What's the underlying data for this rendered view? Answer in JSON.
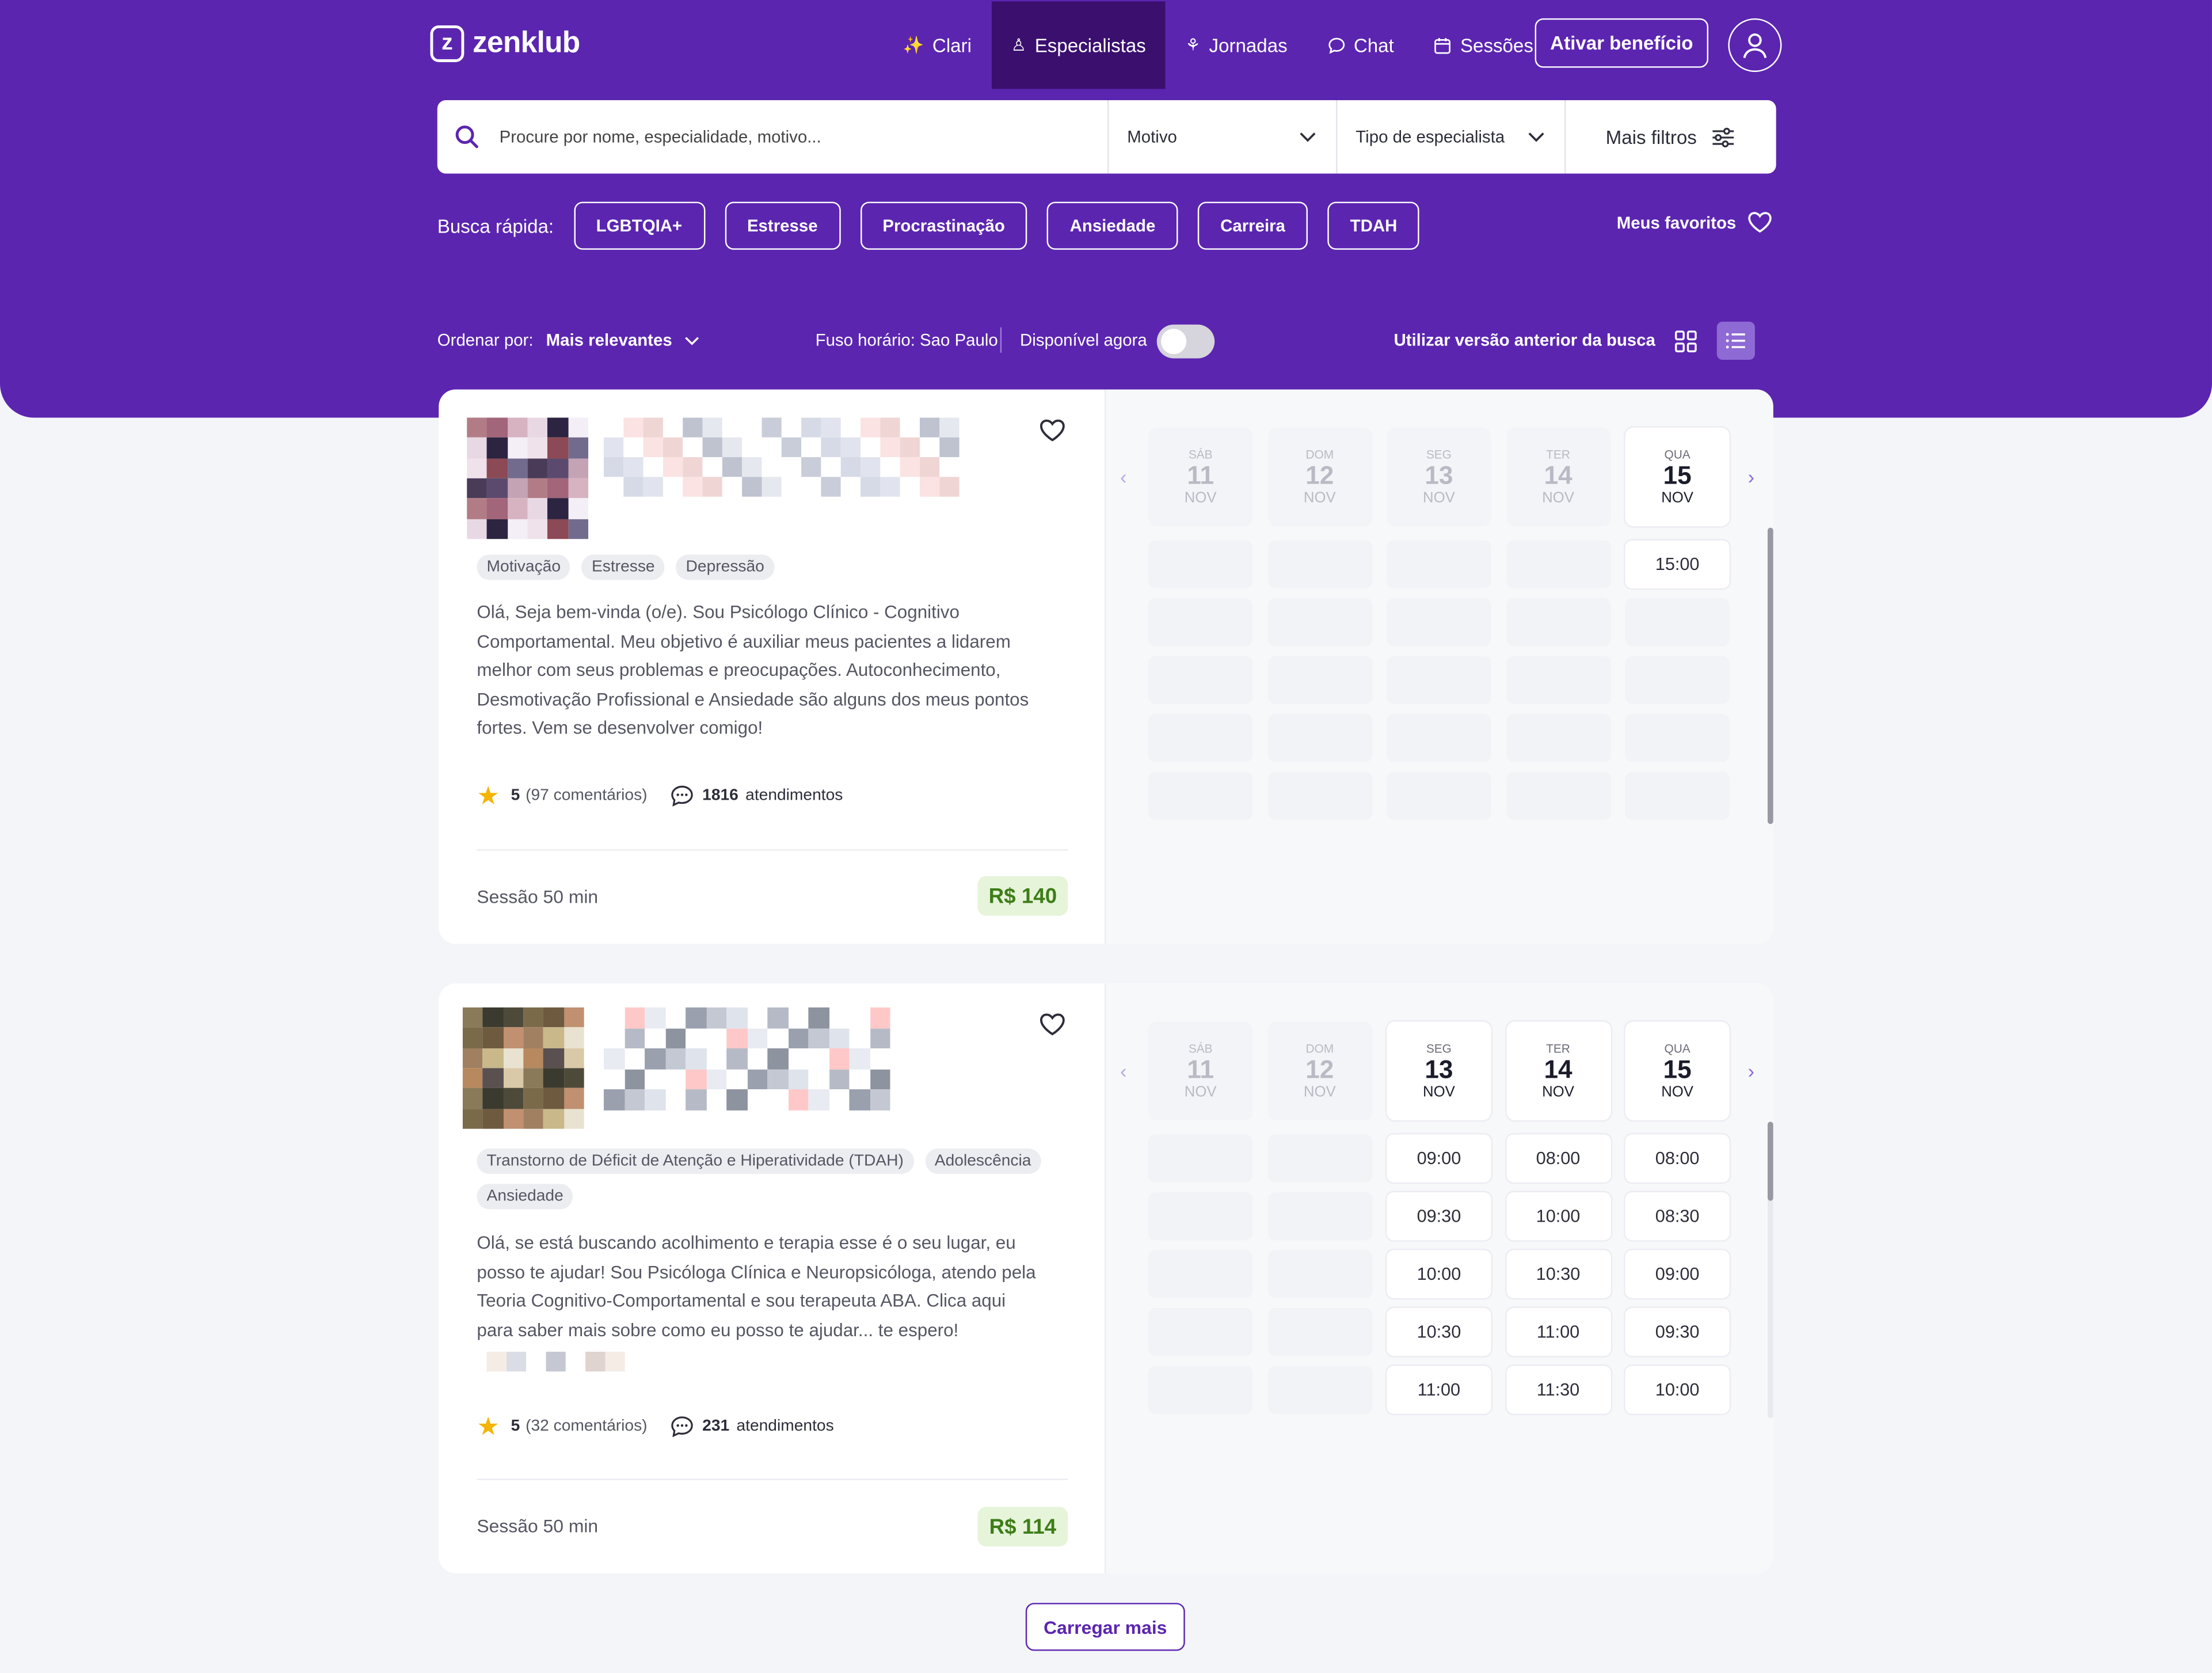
{
  "brand": {
    "name": "zenklub",
    "mark": "z",
    "primary": "#5b25b0"
  },
  "nav": {
    "items": [
      {
        "label": "Clari",
        "icon": "sparkles-icon",
        "glyph": "✨"
      },
      {
        "label": "Especialistas",
        "icon": "specialist-icon",
        "glyph": "♙"
      },
      {
        "label": "Jornadas",
        "icon": "journey-icon",
        "glyph": "⚘"
      },
      {
        "label": "Chat",
        "icon": "chat-icon",
        "glyph": "◌"
      },
      {
        "label": "Sessões",
        "icon": "calendar-icon",
        "glyph": "▦"
      }
    ],
    "active": "Especialistas",
    "benefit_button": "Ativar benefício"
  },
  "search": {
    "placeholder": "Procure por nome, especialidade, motivo...",
    "motivo": "Motivo",
    "tipo": "Tipo de especialista",
    "mais_filtros": "Mais filtros"
  },
  "quick": {
    "label": "Busca rápida:",
    "chips": [
      "LGBTQIA+",
      "Estresse",
      "Procrastinação",
      "Ansiedade",
      "Carreira",
      "TDAH"
    ],
    "favorites": "Meus favoritos"
  },
  "sort": {
    "label": "Ordenar por:",
    "value": "Mais relevantes",
    "timezone": "Fuso horário: Sao Paulo",
    "available_now": "Disponível agora",
    "available_now_on": false,
    "old_version": "Utilizar versão anterior da busca",
    "view_mode": "list"
  },
  "cards": [
    {
      "tags": [
        "Motivação",
        "Estresse",
        "Depressão"
      ],
      "bio": "Olá, Seja bem-vinda (o/e). Sou Psicólogo Clínico - Cognitivo Comportamental. Meu objetivo é auxiliar meus pacientes a lidarem melhor com seus problemas e preocupações. Autoconhecimento, Desmotivação Profissional e Ansiedade são alguns dos meus pontos fortes. Vem se desenvolver comigo!",
      "rating": "5",
      "reviews": "(97 comentários)",
      "sessions": "1816",
      "sessions_label": "atendimentos",
      "duration": "Sessão 50 min",
      "price": "R$ 140",
      "days": [
        {
          "dw": "SÁB",
          "dn": "11",
          "dm": "NOV",
          "on": false,
          "slots": []
        },
        {
          "dw": "DOM",
          "dn": "12",
          "dm": "NOV",
          "on": false,
          "slots": []
        },
        {
          "dw": "SEG",
          "dn": "13",
          "dm": "NOV",
          "on": false,
          "slots": []
        },
        {
          "dw": "TER",
          "dn": "14",
          "dm": "NOV",
          "on": false,
          "slots": []
        },
        {
          "dw": "QUA",
          "dn": "15",
          "dm": "NOV",
          "on": true,
          "slots": [
            "15:00"
          ]
        }
      ]
    },
    {
      "tags": [
        "Transtorno de Déficit de Atenção e Hiperatividade (TDAH)",
        "Adolescência",
        "Ansiedade"
      ],
      "bio": "Olá, se está buscando acolhimento e terapia esse é o seu lugar, eu posso te ajudar! Sou Psicóloga Clínica e Neuropsicóloga, atendo pela Teoria Cognitivo-Comportamental e sou terapeuta ABA. Clica aqui para saber mais sobre como eu posso te ajudar... te espero!",
      "rating": "5",
      "reviews": "(32 comentários)",
      "sessions": "231",
      "sessions_label": "atendimentos",
      "duration": "Sessão 50 min",
      "price": "R$ 114",
      "days": [
        {
          "dw": "SÁB",
          "dn": "11",
          "dm": "NOV",
          "on": false,
          "slots": []
        },
        {
          "dw": "DOM",
          "dn": "12",
          "dm": "NOV",
          "on": false,
          "slots": []
        },
        {
          "dw": "SEG",
          "dn": "13",
          "dm": "NOV",
          "on": true,
          "slots": [
            "09:00",
            "09:30",
            "10:00",
            "10:30",
            "11:00"
          ]
        },
        {
          "dw": "TER",
          "dn": "14",
          "dm": "NOV",
          "on": true,
          "slots": [
            "08:00",
            "10:00",
            "10:30",
            "11:00",
            "11:30"
          ]
        },
        {
          "dw": "QUA",
          "dn": "15",
          "dm": "NOV",
          "on": true,
          "slots": [
            "08:00",
            "08:30",
            "09:00",
            "09:30",
            "10:00"
          ]
        }
      ]
    }
  ],
  "load_more": "Carregar mais"
}
